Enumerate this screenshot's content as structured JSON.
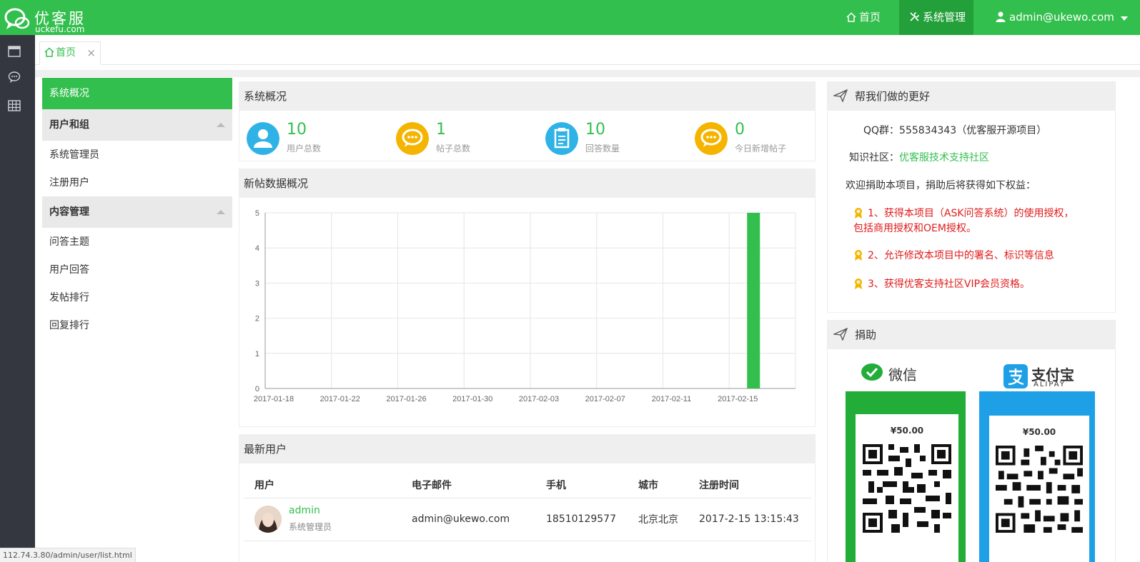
{
  "brand": {
    "name": "优客服",
    "url": "uckefu.com"
  },
  "topnav": {
    "home": "首页",
    "system": "系统管理",
    "user": "admin@ukewo.com"
  },
  "tabs": [
    {
      "label": "首页",
      "close": "×"
    }
  ],
  "menu": {
    "overview": "系统概况",
    "groups": [
      {
        "title": "用户和组",
        "items": [
          "系统管理员",
          "注册用户"
        ]
      },
      {
        "title": "内容管理",
        "items": [
          "问答主题",
          "用户回答",
          "发帖排行",
          "回复排行"
        ]
      }
    ]
  },
  "overview": {
    "title": "系统概况",
    "stats": [
      {
        "value": "10",
        "label": "用户总数",
        "icon": "user-icon",
        "color": "#2fb3e6"
      },
      {
        "value": "1",
        "label": "帖子总数",
        "icon": "chat-bubble-icon",
        "color": "#f4b400"
      },
      {
        "value": "10",
        "label": "回答数量",
        "icon": "clipboard-icon",
        "color": "#2fb3e6"
      },
      {
        "value": "0",
        "label": "今日新增帖子",
        "icon": "chat-bubble-icon",
        "color": "#f4b400"
      }
    ]
  },
  "chart_panel": {
    "title": "新帖数据概况"
  },
  "chart_data": {
    "type": "bar",
    "title": "",
    "xlabel": "",
    "ylabel": "",
    "categories": [
      "2017-01-18",
      "2017-01-22",
      "2017-01-26",
      "2017-01-30",
      "2017-02-03",
      "2017-02-07",
      "2017-02-11",
      "2017-02-15"
    ],
    "values": [
      0,
      0,
      0,
      0,
      0,
      0,
      0,
      5
    ],
    "ylim": [
      0,
      5
    ],
    "yticks": [
      0,
      1,
      2,
      3,
      4,
      5
    ],
    "grid": true,
    "color": "#33bf4d"
  },
  "users_panel": {
    "title": "最新用户",
    "columns": [
      "用户",
      "电子邮件",
      "手机",
      "城市",
      "注册时间"
    ],
    "rows": [
      {
        "name": "admin",
        "role": "系统管理员",
        "email": "admin@ukewo.com",
        "phone": "18510129577",
        "city": "北京北京",
        "time": "2017-2-15 13:15:43"
      }
    ]
  },
  "help_panel": {
    "title": "帮我们做的更好",
    "qq_label": "QQ群：",
    "qq_value": "555834343（优客服开源项目）",
    "community_label": "知识社区：",
    "community_link": "优客服技术支持社区",
    "intro": "欢迎捐助本项目，捐助后将获得如下权益：",
    "benefits": [
      "1、获得本项目（ASK问答系统）的使用授权，",
      "包括商用授权和OEM授权。",
      "2、允许修改本项目中的署名、标识等信息",
      "3、获得优客支持社区VIP会员资格。"
    ]
  },
  "donate_panel": {
    "title": "捐助",
    "wechat": {
      "name": "微信",
      "price": "¥50.00",
      "color": "#22ac38"
    },
    "alipay": {
      "name": "支付宝",
      "sub": "ALIPAY",
      "price": "¥50.00",
      "color": "#1ea0e6"
    }
  },
  "statusbar": {
    "url": "112.74.3.80/admin/user/list.html"
  }
}
